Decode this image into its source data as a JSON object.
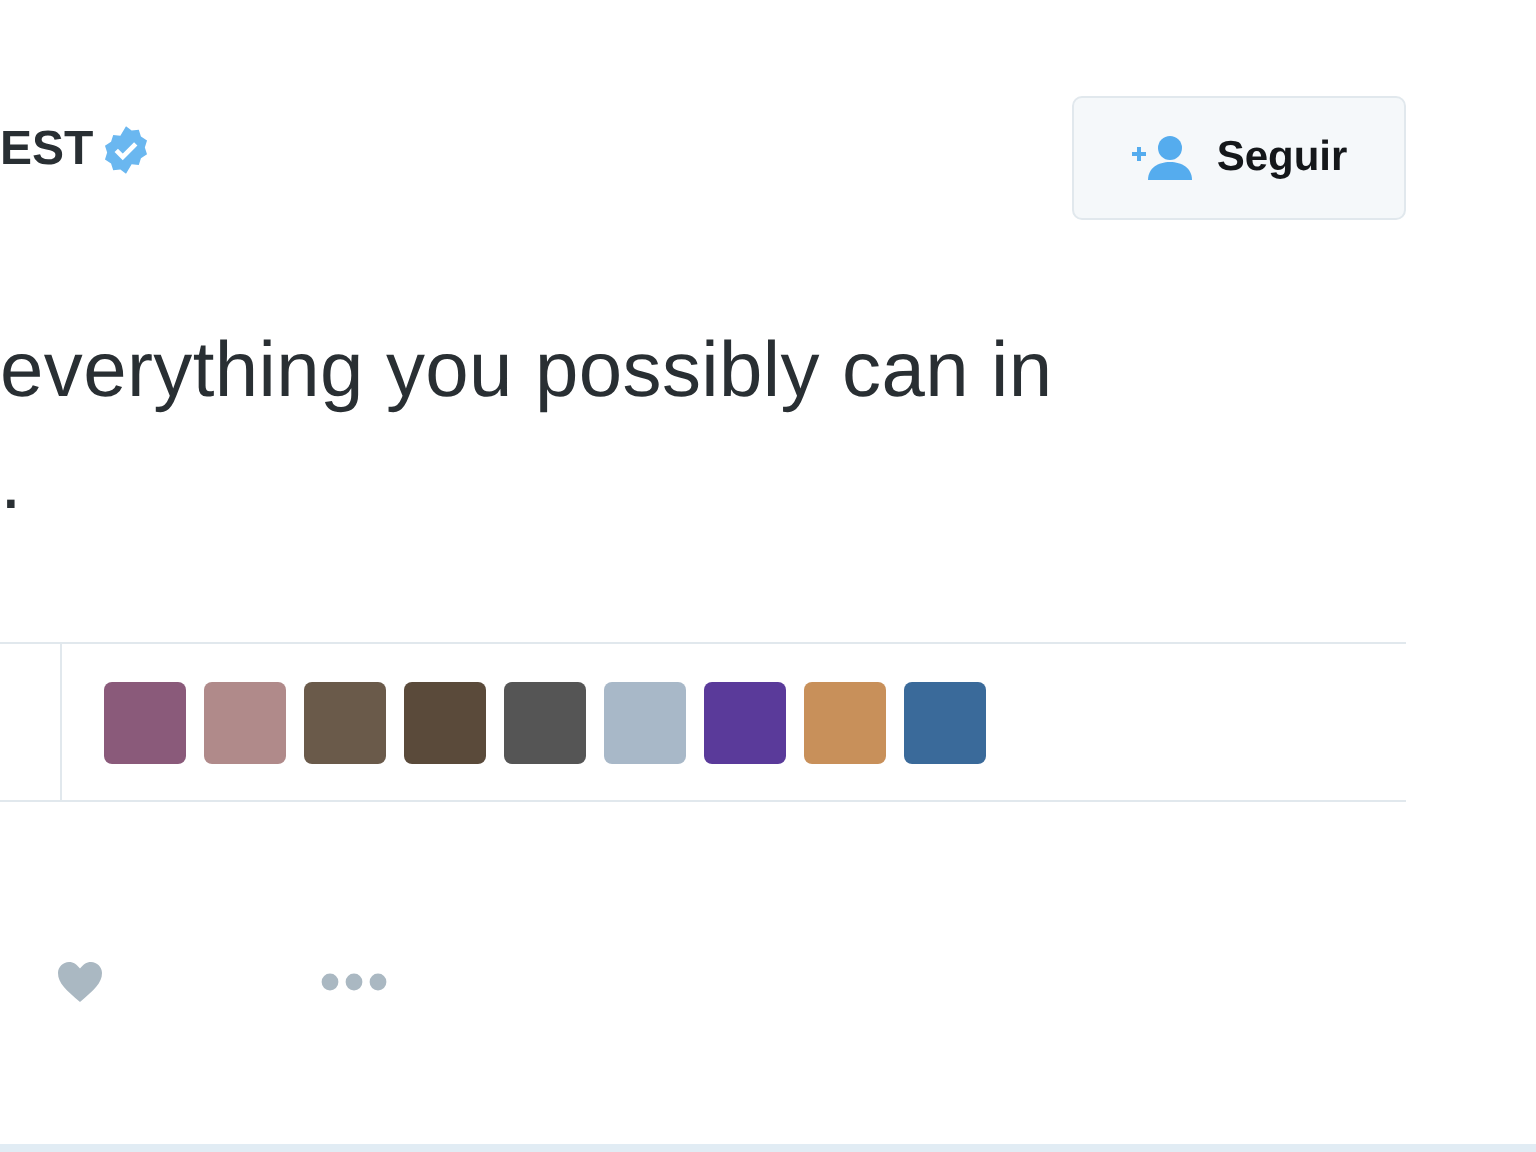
{
  "author": {
    "name": "EST",
    "verified": true
  },
  "follow_button": {
    "label": "Seguir"
  },
  "tweet_text": [
    "everything you possibly can in",
    "."
  ],
  "liked_by_avatars": [
    {
      "kind": "photo"
    },
    {
      "kind": "photo"
    },
    {
      "kind": "photo"
    },
    {
      "kind": "photo"
    },
    {
      "kind": "photo"
    },
    {
      "kind": "photo"
    },
    {
      "kind": "photo"
    },
    {
      "kind": "photo"
    },
    {
      "kind": "photo"
    }
  ]
}
